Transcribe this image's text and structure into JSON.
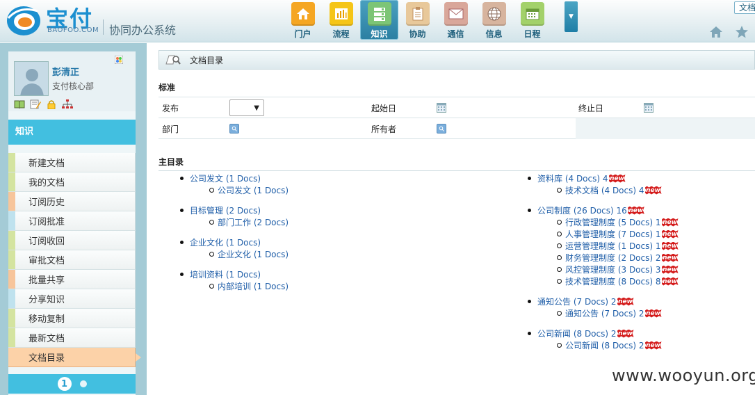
{
  "header": {
    "logo_text": "宝付",
    "logo_sub": "BAOFOO.COM",
    "system_name": "协同办公系统",
    "nav": [
      {
        "label": "门户",
        "icon": "home-icon",
        "color": "#f5a623"
      },
      {
        "label": "流程",
        "icon": "bar-chart-icon",
        "color": "#f5c518"
      },
      {
        "label": "知识",
        "icon": "database-icon",
        "color": "#7cc576",
        "active": true
      },
      {
        "label": "协助",
        "icon": "clipboard-icon",
        "color": "#e8c89a"
      },
      {
        "label": "通信",
        "icon": "mail-icon",
        "color": "#d9a79a"
      },
      {
        "label": "信息",
        "icon": "globe-icon",
        "color": "#d7b49e"
      },
      {
        "label": "日程",
        "icon": "calendar-icon",
        "color": "#a3d16a"
      }
    ],
    "top_right_button": "文档"
  },
  "sidebar": {
    "user": {
      "name": "彭清正",
      "dept": "支付核心部"
    },
    "section_title": "知识",
    "menu": [
      {
        "label": "新建文档",
        "stripe": "#d4e4a0"
      },
      {
        "label": "我的文档",
        "stripe": "#d4e4a0"
      },
      {
        "label": "订阅历史",
        "stripe": "#f7c59b"
      },
      {
        "label": "订阅批准",
        "stripe": "#bfe2ee"
      },
      {
        "label": "订阅收回",
        "stripe": "#d4e4a0"
      },
      {
        "label": "审批文档",
        "stripe": "#d4e4a0"
      },
      {
        "label": "批量共享",
        "stripe": "#f7c59b"
      },
      {
        "label": "分享知识",
        "stripe": "#bfe2ee"
      },
      {
        "label": "移动复制",
        "stripe": "#d4e4a0"
      },
      {
        "label": "最新文档",
        "stripe": "#d4e4a0"
      },
      {
        "label": "文档目录",
        "stripe": "#fcd2a8",
        "active": true
      }
    ],
    "pager": {
      "current": "1"
    }
  },
  "main": {
    "breadcrumb": "文档目录",
    "standard_title": "标准",
    "filters": {
      "publish_label": "发布",
      "start_date_label": "起始日",
      "end_date_label": "终止日",
      "department_label": "部门",
      "owner_label": "所有者"
    },
    "catalog_title": "主目录",
    "catalog_left": [
      {
        "parent": "公司发文 (1 Docs)",
        "children": [
          {
            "label": "公司发文 (1 Docs)"
          }
        ]
      },
      {
        "parent": "目标管理 (2 Docs)",
        "children": [
          {
            "label": "部门工作 (2 Docs)"
          }
        ]
      },
      {
        "parent": "企业文化 (1 Docs)",
        "children": [
          {
            "label": "企业文化 (1 Docs)"
          }
        ]
      },
      {
        "parent": "培训资料 (1 Docs)",
        "children": [
          {
            "label": "内部培训 (1 Docs)"
          }
        ]
      }
    ],
    "catalog_right": [
      {
        "parent": "资料库 (4 Docs)",
        "parent_new": "4",
        "children": [
          {
            "label": "技术文档 (4 Docs)",
            "new": "4"
          }
        ]
      },
      {
        "parent": "公司制度 (26 Docs)",
        "parent_new": "16",
        "children": [
          {
            "label": "行政管理制度 (5 Docs)",
            "new": "1"
          },
          {
            "label": "人事管理制度 (7 Docs)",
            "new": "1"
          },
          {
            "label": "运营管理制度 (1 Docs)",
            "new": "1"
          },
          {
            "label": "财务管理制度 (2 Docs)",
            "new": "2"
          },
          {
            "label": "风控管理制度 (3 Docs)",
            "new": "3"
          },
          {
            "label": "技术管理制度 (8 Docs)",
            "new": "8"
          }
        ]
      },
      {
        "parent": "通知公告 (7 Docs)",
        "parent_new": "2",
        "children": [
          {
            "label": "通知公告 (7 Docs)",
            "new": "2"
          }
        ]
      },
      {
        "parent": "公司新闻 (8 Docs)",
        "parent_new": "2",
        "children": [
          {
            "label": "公司新闻 (8 Docs)",
            "new": "2"
          }
        ]
      }
    ],
    "new_badge_text": "new"
  },
  "watermark": "www.wooyun.org"
}
